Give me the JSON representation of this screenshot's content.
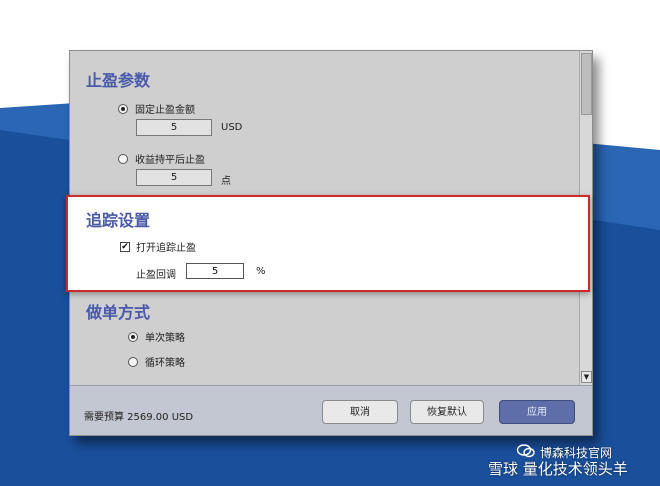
{
  "dialog": {
    "profit_section": {
      "title": "止盈参数",
      "option_fixed": {
        "label": "固定止盈金额",
        "selected": true,
        "value": "5",
        "unit": "USD"
      },
      "option_ratio": {
        "label": "收益持平后止盈",
        "selected": false,
        "value": "5",
        "unit": "点"
      }
    },
    "trailing_section": {
      "title": "追踪设置",
      "enable_label": "打开追踪止盈",
      "enabled": true,
      "check_mark": "✔",
      "retrace_label": "止盈回调",
      "retrace_value": "5",
      "retrace_unit": "%"
    },
    "order_section": {
      "title": "做单方式",
      "option_single": {
        "label": "单次策略",
        "selected": true
      },
      "option_loop": {
        "label": "循环策略",
        "selected": false
      }
    },
    "footer": {
      "budget_text": "需要预算 2569.00 USD",
      "cancel_label": "取消",
      "reset_label": "恢复默认",
      "apply_label": "应用"
    }
  },
  "watermark": {
    "line1": "博森科技官网",
    "line2": "雪球 量化技术领头羊"
  },
  "colors": {
    "section_title": "#4a5aa8",
    "highlight_border": "#cc2a2a",
    "primary_button": "#5e6ea8",
    "background_blue": "#1f5fae"
  },
  "icons": {
    "scroll_down": "▼",
    "watermark_logo": "wechat-icon"
  }
}
